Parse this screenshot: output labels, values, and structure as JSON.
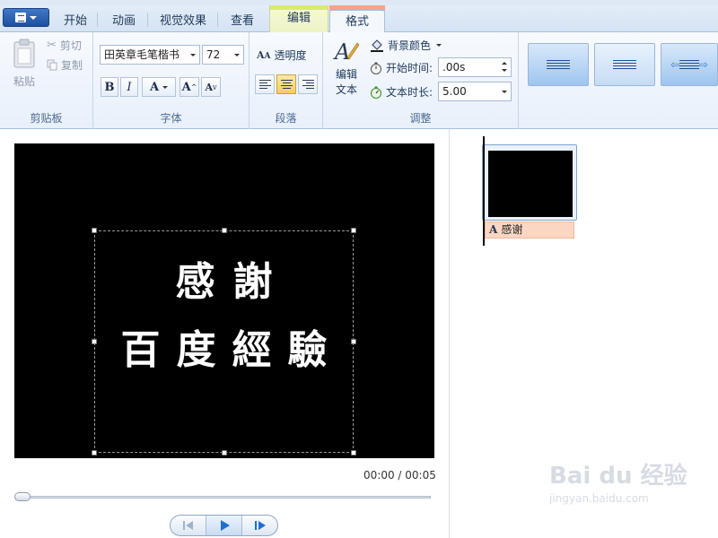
{
  "tabs": {
    "file_menu_icon": "document-menu-icon",
    "home": "开始",
    "animation": "动画",
    "visual_effects": "视觉效果",
    "view": "查看",
    "edit": "编辑",
    "format": "格式"
  },
  "clipboard": {
    "paste": "粘贴",
    "cut": "剪切",
    "copy": "复制",
    "label": "剪贴板"
  },
  "font": {
    "family": "田英章毛笔楷书",
    "size": "72",
    "bold": "B",
    "italic": "I",
    "color": "A",
    "grow": "A",
    "shrink": "A",
    "label": "字体"
  },
  "paragraph": {
    "transparency": "透明度",
    "label": "段落"
  },
  "adjust": {
    "edit_text_line1": "编辑",
    "edit_text_line2": "文本",
    "background_color": "背景颜色",
    "start_time_label": "开始时间:",
    "start_time_value": ".00s",
    "duration_label": "文本时长:",
    "duration_value": "5.00",
    "label": "调整"
  },
  "preview": {
    "caption_line1": "感謝",
    "caption_line2": "百度經驗",
    "timecode": "00:00 / 00:05"
  },
  "storyboard": {
    "clip_caption": "感谢"
  },
  "watermark": {
    "brand": "Bai du 经验",
    "url": "jingyan.baidu.com"
  },
  "colors": {
    "ribbon_bg": "#e8f0fa",
    "active_tab_accent": "#f4a38a",
    "context_tab": "#d9eb6e",
    "preview_bg": "#000000",
    "clip_label_bg": "#fbd7c3"
  }
}
